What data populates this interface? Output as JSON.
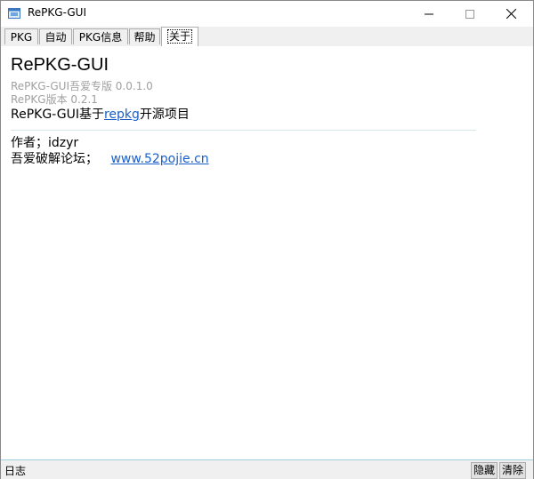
{
  "window": {
    "title": "RePKG-GUI"
  },
  "tabs": [
    {
      "label": "PKG"
    },
    {
      "label": "自动"
    },
    {
      "label": "PKG信息"
    },
    {
      "label": "帮助"
    },
    {
      "label": "关于"
    }
  ],
  "about": {
    "app_name": "RePKG-GUI",
    "version_line": "RePKG-GUI吾爱专版 0.0.1.0",
    "repkg_version": "RePKG版本 0.2.1",
    "desc_prefix": "RePKG-GUI基于",
    "desc_link": "repkg",
    "desc_suffix": "开源项目",
    "author": "作者；idzyr",
    "site_label": "吾爱破解论坛；",
    "site_link": "www.52pojie.cn"
  },
  "status": {
    "log_label": "日志",
    "hide_label": "隐藏",
    "clear_label": "清除"
  }
}
